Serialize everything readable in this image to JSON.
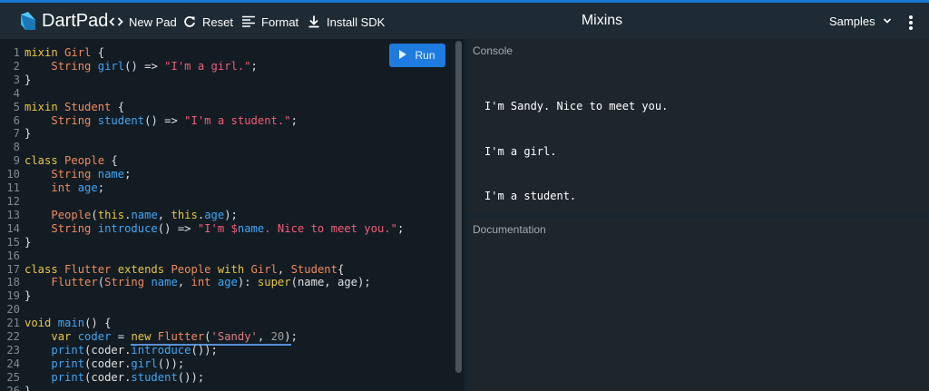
{
  "appbar": {
    "brand": "DartPad",
    "new_pad": "New Pad",
    "reset": "Reset",
    "format": "Format",
    "install_sdk": "Install SDK",
    "title": "Mixins",
    "samples": "Samples"
  },
  "editor": {
    "run_label": "Run",
    "line_numbers": [
      "1",
      "2",
      "3",
      "4",
      "5",
      "6",
      "7",
      "8",
      "9",
      "10",
      "11",
      "12",
      "13",
      "14",
      "15",
      "16",
      "17",
      "18",
      "19",
      "20",
      "21",
      "22",
      "23",
      "24",
      "25",
      "26"
    ],
    "code_lines": [
      "mixin Girl {",
      "    String girl() => \"I'm a girl.\";",
      "}",
      "",
      "mixin Student {",
      "    String student() => \"I'm a student.\";",
      "}",
      "",
      "class People {",
      "    String name;",
      "    int age;",
      "",
      "    People(this.name, this.age);",
      "    String introduce() => \"I'm $name. Nice to meet you.\";",
      "}",
      "",
      "class Flutter extends People with Girl, Student{",
      "    Flutter(String name, int age): super(name, age);",
      "}",
      "",
      "void main() {",
      "    var coder = new Flutter('Sandy', 20);",
      "    print(coder.introduce());",
      "    print(coder.girl());",
      "    print(coder.student());",
      "}"
    ]
  },
  "console": {
    "title": "Console",
    "output": [
      "I'm Sandy. Nice to meet you.",
      "I'm a girl.",
      "I'm a student."
    ]
  },
  "documentation": {
    "title": "Documentation"
  },
  "colors": {
    "accent": "#1976d2",
    "run_button": "#1e7be0",
    "keyword": "#e8c547",
    "type": "#f08a5d",
    "function": "#42a5f5",
    "string": "#f45c79"
  },
  "icons": [
    "dart-logo-icon",
    "code-icon",
    "refresh-icon",
    "format-icon",
    "download-icon",
    "chevron-down-icon",
    "more-vert-icon",
    "play-icon"
  ]
}
